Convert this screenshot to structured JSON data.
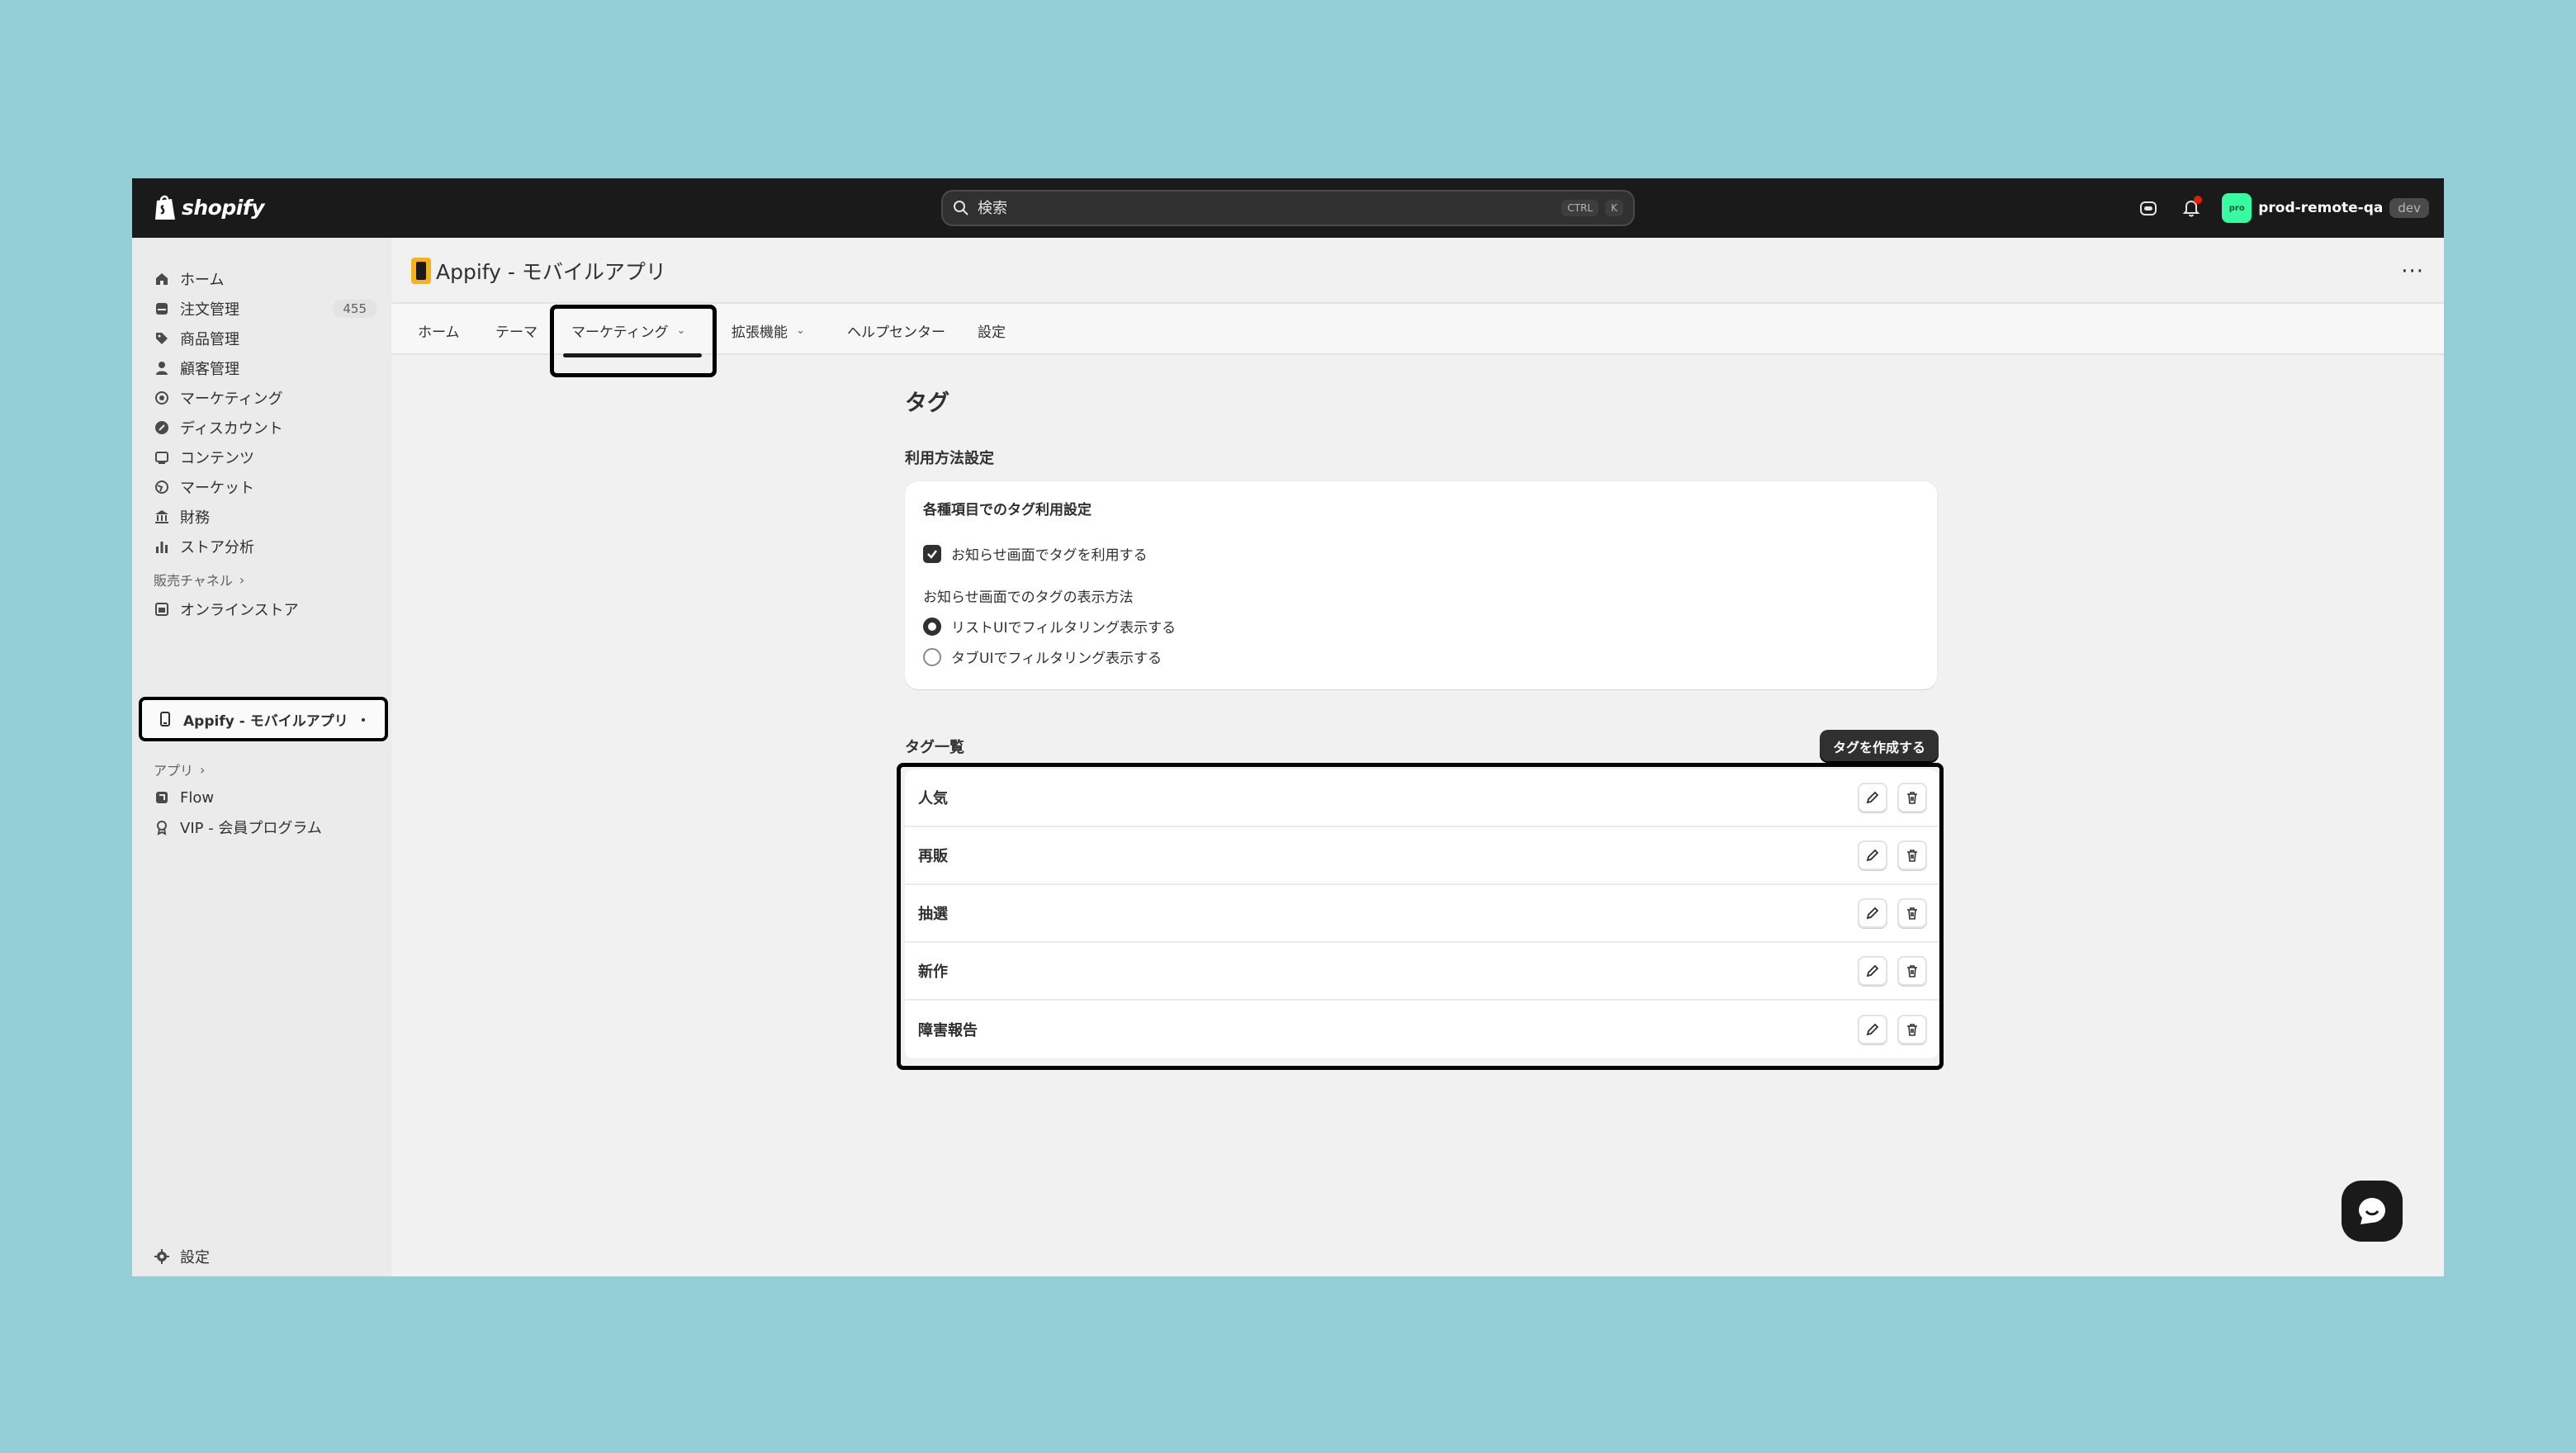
{
  "topbar": {
    "brand": "shopify",
    "search_placeholder": "検索",
    "shortcut_ctrl": "CTRL",
    "shortcut_key": "K",
    "avatar_text": "pro",
    "store_name": "prod-remote-qa",
    "store_badge": "dev"
  },
  "sidebar": {
    "items": [
      {
        "label": "ホーム",
        "icon": "home-icon"
      },
      {
        "label": "注文管理",
        "icon": "orders-icon",
        "count": "455"
      },
      {
        "label": "商品管理",
        "icon": "tag-icon"
      },
      {
        "label": "顧客管理",
        "icon": "person-icon"
      },
      {
        "label": "マーケティング",
        "icon": "target-icon"
      },
      {
        "label": "ディスカウント",
        "icon": "discount-icon"
      },
      {
        "label": "コンテンツ",
        "icon": "content-icon"
      },
      {
        "label": "マーケット",
        "icon": "globe-icon"
      },
      {
        "label": "財務",
        "icon": "bank-icon"
      },
      {
        "label": "ストア分析",
        "icon": "chart-icon"
      }
    ],
    "sales_channels_label": "販売チャネル",
    "online_store": "オンラインストア",
    "selected_app": "Appify - モバイルアプリ",
    "apps_label": "アプリ",
    "apps": [
      {
        "label": "Flow"
      },
      {
        "label": "VIP - 会員プログラム"
      }
    ],
    "settings": "設定"
  },
  "app": {
    "title": "Appify - モバイルアプリ",
    "more": "···",
    "tabs": [
      {
        "label": "ホーム"
      },
      {
        "label": "テーマ"
      },
      {
        "label": "マーケティング"
      },
      {
        "label": "拡張機能"
      },
      {
        "label": "ヘルプセンター"
      },
      {
        "label": "設定"
      }
    ]
  },
  "page": {
    "title": "タグ",
    "usage_section": "利用方法設定",
    "card_heading": "各種項目でのタグ利用設定",
    "checkbox_label": "お知らせ画面でタグを利用する",
    "checkbox_checked": true,
    "display_label": "お知らせ画面でのタグの表示方法",
    "radio_options": [
      {
        "label": "リストUIでフィルタリング表示する",
        "checked": true
      },
      {
        "label": "タブUIでフィルタリング表示する",
        "checked": false
      }
    ],
    "list_title": "タグ一覧",
    "create_button": "タグを作成する",
    "tags": [
      {
        "name": "人気"
      },
      {
        "name": "再販"
      },
      {
        "name": "抽選"
      },
      {
        "name": "新作"
      },
      {
        "name": "障害報告"
      }
    ]
  },
  "colors": {
    "background": "#94ced6",
    "topbar": "#1a1a1a",
    "accent": "#303030",
    "avatar": "#36fba1",
    "notification": "#e51c00"
  }
}
